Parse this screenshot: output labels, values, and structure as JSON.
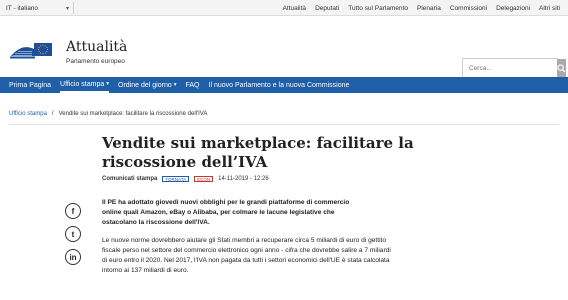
{
  "topbar": {
    "language": "IT - italiano",
    "links": [
      "Attualità",
      "Deputati",
      "Tutto sul Parlamento",
      "Plenaria",
      "Commissioni",
      "Delegazioni",
      "Altri siti"
    ]
  },
  "header": {
    "title": "Attualità",
    "subtitle": "Parlamento europeo",
    "search_placeholder": "Cerca..."
  },
  "nav": {
    "items": [
      "Prima Pagina",
      "Ufficio stampa",
      "Ordine del giorno",
      "FAQ",
      "Il nuovo Parlamento e la nuova Commissione"
    ]
  },
  "breadcrumb": {
    "root": "Ufficio stampa",
    "separator": "/",
    "current": "Vendite sui marketplace: facilitare la riscossione dell'IVA"
  },
  "article": {
    "title": "Vendite sui marketplace: facilitare la riscossione dell’IVA",
    "category": "Comunicati stampa",
    "badge1": "TORNATA",
    "badge2": "ECON",
    "date": "14-11-2019 - 12:26",
    "lead": "Il PE ha adottato giovedì nuovi obblighi per le grandi piattaforme di commercio online quali Amazon, eBay o Alibaba, per colmare le lacune legislative che ostacolano la riscossione dell'IVA.",
    "body": "Le nuove norme dovrebbero aiutare gli Stati membri a recuperare circa 5 miliardi di euro di gettito fiscale perso nel settore del commercio elettronico ogni anno - cifra che dovrebbe salire a 7 miliardi di euro entro il 2020. Nel 2017, l'IVA non pagata da tutti i settori economici dell'UE è stata calcolata intorno ai 137 miliardi di euro."
  },
  "share": {
    "facebook": "f",
    "twitter": "t",
    "linkedin": "in"
  },
  "colors": {
    "nav_blue": "#1e5fa8",
    "eu_flag_blue": "#1f4e9c",
    "eu_star_yellow": "#f4c400"
  }
}
